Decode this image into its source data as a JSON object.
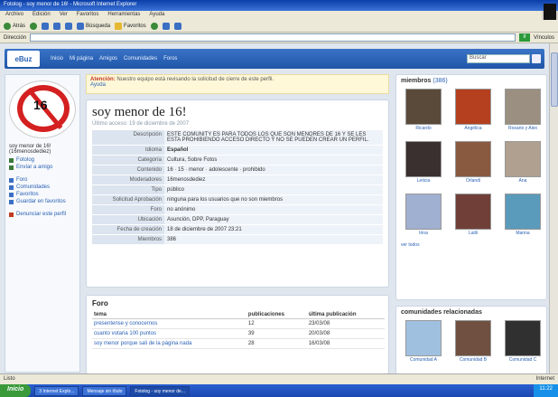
{
  "window": {
    "title": "Fotolog - soy menor de 16! - Microsoft Internet Explorer"
  },
  "menu": [
    "Archivo",
    "Edición",
    "Ver",
    "Favoritos",
    "Herramientas",
    "Ayuda"
  ],
  "toolbar": {
    "back": "Atrás",
    "search": "Búsqueda",
    "favorites": "Favoritos"
  },
  "address": {
    "label": "Dirección",
    "go": "Ir",
    "links": "Vínculos"
  },
  "site": {
    "logo": "eBuz",
    "nav": [
      "Inicio",
      "Mi página",
      "Amigos",
      "Comunidades",
      "Foros"
    ],
    "search_placeholder": "Buscar"
  },
  "left": {
    "badge_number": "16",
    "name": "soy menor de 16! (16menosdediez)",
    "links": [
      "Fotolog",
      "Envíar a amigo",
      "Foro",
      "Comunidades",
      "Favoritos",
      "Guardar en favoritos",
      "Denunciar este perfil"
    ]
  },
  "notice": {
    "bold": "Atención:",
    "text": "Nuestro equipo está revisando la solicitud de cierre de este perfil.",
    "link": "Ayuda"
  },
  "profile": {
    "title": "soy menor de 16!",
    "subtitle": "Último acceso: 19 de diciembre de 2007",
    "rows": [
      {
        "k": "Descripción",
        "v": "ESTE COMUNITY ES PARA TODOS LOS QUE SON MENORES DE 16 Y SE LES ESTA PROHIBIENDO ACCESO DIRECTO Y NO SE PUEDEN CREAR UN PERFIL."
      },
      {
        "k": "Idioma",
        "v": "Español",
        "bold": true
      },
      {
        "k": "Categoría",
        "v": "Cultura, Sobre Fotos"
      },
      {
        "k": "Contenido",
        "v": "16 · 15 · menor · adolescente · prohibido"
      },
      {
        "k": "Moderadores",
        "v": "16menosdediez"
      },
      {
        "k": "Tipo",
        "v": "público"
      },
      {
        "k": "Solicitud Aprobación",
        "v": "ninguna para los usuarios que no son miembros"
      },
      {
        "k": "Foro",
        "v": "no anónimo"
      },
      {
        "k": "Ubicación",
        "v": "Asunción, DPP, Paraguay"
      },
      {
        "k": "Fecha de creación",
        "v": "18 de diciembre de 2007 23:21"
      },
      {
        "k": "Miembros",
        "v": "386"
      }
    ]
  },
  "foro": {
    "title": "Foro",
    "headers": [
      "tema",
      "publicaciones",
      "última publicación"
    ],
    "rows": [
      {
        "tema": "presentense y conocernos",
        "posts": "12",
        "last": "23/03/08"
      },
      {
        "tema": "cuanto votaria 100 puntos",
        "posts": "39",
        "last": "20/03/08"
      },
      {
        "tema": "soy menor porque sali de la página nada",
        "posts": "28",
        "last": "16/03/08"
      }
    ]
  },
  "amigos": {
    "title": "miembros",
    "count": "(386)",
    "captions": [
      "Ricardo",
      "Angélica",
      "Rosario y Alex",
      "Leticia",
      "Orlandi",
      "Ana",
      "Irina",
      "Lalili",
      "Marina"
    ],
    "colors": [
      "#5a4a3a",
      "#b44020",
      "#9a8f80",
      "#3b3030",
      "#8a5a40",
      "#b0a090",
      "#a0b0d0",
      "#704038",
      "#5a9aba"
    ],
    "see_all": "ver todos"
  },
  "comunidades": {
    "title": "comunidades relacionadas",
    "captions": [
      "Comunidad A",
      "Comunidad B",
      "Comunidad C"
    ],
    "colors": [
      "#a0c0e0",
      "#705040",
      "#303030"
    ]
  },
  "status": {
    "left": "Listo",
    "right": "Internet"
  },
  "taskbar": {
    "start": "Inicio",
    "tasks": [
      "3 Internet Explo...",
      "Mensaje sin título",
      "Fotolog - soy menor de..."
    ],
    "clock": "11:22"
  }
}
